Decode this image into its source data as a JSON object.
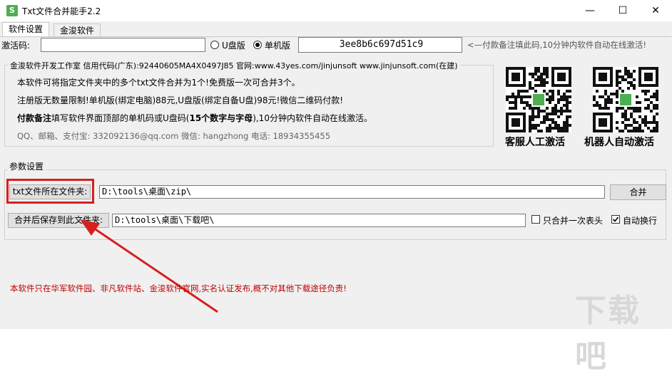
{
  "window": {
    "title": "Txt文件合并能手2.2",
    "icon_name": "app-logo-icon",
    "controls": {
      "minimize": "—",
      "maximize": "☐",
      "close": "✕"
    }
  },
  "tabs": [
    {
      "label": "软件设置"
    },
    {
      "label": "金浚软件"
    }
  ],
  "activation": {
    "label": "激活码:",
    "code_value": "",
    "radio_usb": "U盘版",
    "radio_local": "单机版",
    "selected": "单机版",
    "machine_code": "3ee8b6c697d51c9",
    "hint": "<—付款备注填此码,10分钟内软件自动在线激活!"
  },
  "info": {
    "group_title": "金浚软件开发工作室 信用代码(广东):92440605MA4X0497J85 官网:www.43yes.com/jinjunsoft  www.jinjunsoft.com(在建)",
    "line1": "本软件可将指定文件夹中的多个txt文件合并为1个!免费版一次可合并3个。",
    "line2": "注册版无数量限制!单机版(绑定电脑)88元,U盘版(绑定自备U盘)98元!微信二维码付款!",
    "line3_bold": "付款备注",
    "line3_rest": "填写软件界面顶部的单机码或U盘码(",
    "line3_bold2": "15个数字与字母",
    "line3_end": "),10分钟内软件自动在线激活。",
    "contact": "QQ、邮箱、支付宝: 332092136@qq.com   微信: hangzhong   电话: 18934355455"
  },
  "qr": [
    {
      "caption": "客服人工激活"
    },
    {
      "caption": "机器人自动激活"
    }
  ],
  "params": {
    "group_title": "参数设置",
    "folder_button": "txt文件所在文件夹:",
    "folder_value": "D:\\tools\\桌面\\zip\\",
    "merge_button": "合并",
    "save_button": "合并后保存到此文件夹:",
    "save_value": "D:\\tools\\桌面\\下载吧\\",
    "chk_header_label": "只合并一次表头",
    "chk_header_checked": false,
    "chk_wrap_label": "自动换行",
    "chk_wrap_checked": true
  },
  "footer_notice": "本软件只在华军软件园、非凡软件站、金浚软件官网,实名认证发布,概不对其他下载途径负责!",
  "watermark": "下载吧",
  "colors": {
    "highlight_red": "#d62020",
    "notice_red": "#c00000",
    "brand_green": "#4caf50"
  }
}
